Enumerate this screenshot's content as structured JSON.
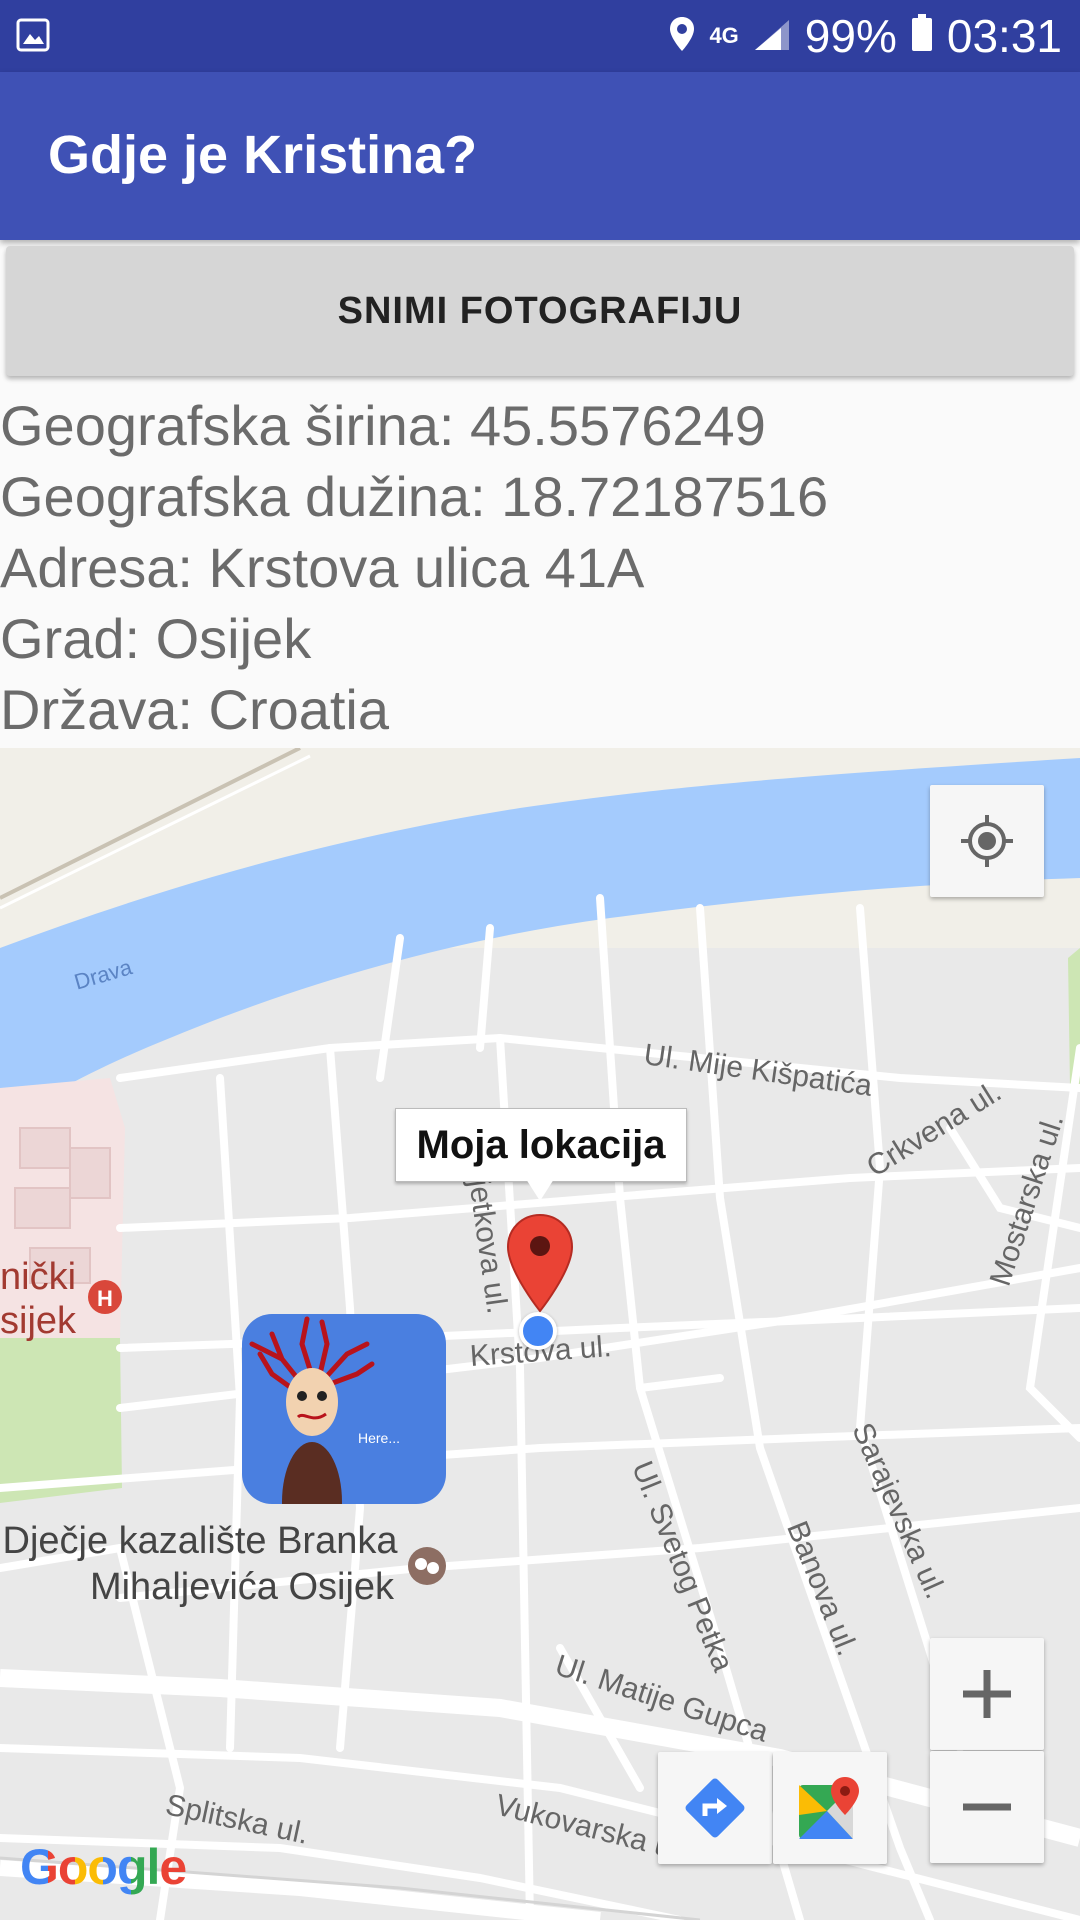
{
  "status_bar": {
    "network": "4G",
    "battery": "99%",
    "time": "03:31"
  },
  "app_bar": {
    "title": "Gdje je Kristina?"
  },
  "capture_button": {
    "label": "SNIMI FOTOGRAFIJU"
  },
  "location_info": {
    "latitude": "Geografska širina: 45.5576249",
    "longitude": "Geografska dužina: 18.72187516",
    "address": "Adresa: Krstova ulica 41A",
    "city": "Grad: Osijek",
    "country": "Država: Croatia"
  },
  "map": {
    "marker_title": "Moja lokacija",
    "photo_caption": "Here...",
    "attribution": "Google",
    "labels": {
      "river": "Drava",
      "street_mije": "Ul. Mije Kišpatića",
      "street_crkvena": "Crkvena ul.",
      "street_mostarska": "Mostarska ul.",
      "street_cvjetkova": "vjetkova ul.",
      "street_krstova": "Krstova ul.",
      "street_svetog_petka": "Ul. Svetog Petka",
      "street_banova": "Banova ul.",
      "street_sarajevska": "Sarajevska ul.",
      "street_matije_gupca": "Ul. Matije Gupca",
      "street_vukovarska": "Vukovarska ul.",
      "street_splitska": "Splitska ul.",
      "hospital_line1": "nički",
      "hospital_line2": "sijek",
      "theatre_line1": "Dječje kazalište Branka",
      "theatre_line2": "Mihaljevića Osijek"
    },
    "colors": {
      "river": "#a4cbfd",
      "marker": "#ea4335",
      "my_location": "#4285f4",
      "park": "#cde6b4",
      "hospital_area": "#f5e3e3"
    }
  }
}
